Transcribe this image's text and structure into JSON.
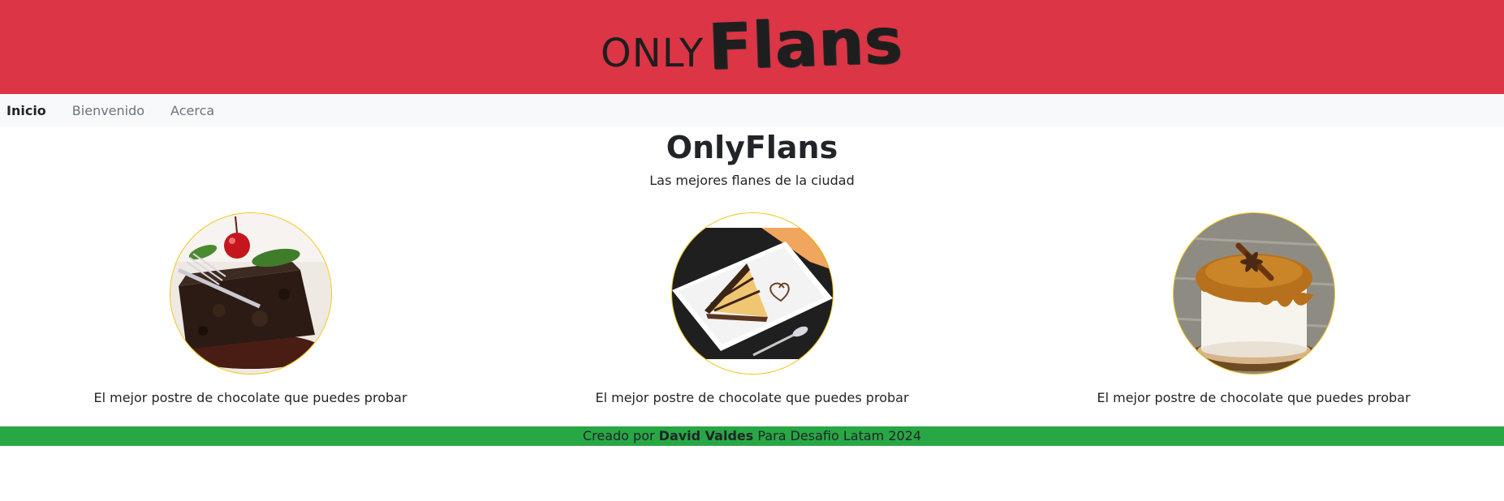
{
  "header": {
    "logo_only": "ONLY",
    "logo_flans": "Flans",
    "background_color": "#dc3545"
  },
  "nav": {
    "items": [
      {
        "label": "Inicio",
        "active": true
      },
      {
        "label": "Bienvenido",
        "active": false
      },
      {
        "label": "Acerca",
        "active": false
      }
    ]
  },
  "main": {
    "title": "OnlyFlans",
    "subtitle": "Las mejores flanes de la ciudad"
  },
  "cards": [
    {
      "image_icon": "chocolate-cake-image",
      "caption": "El mejor postre de chocolate que puedes probar"
    },
    {
      "image_icon": "cake-slice-plate-image",
      "caption": "El mejor postre de chocolate que puedes probar"
    },
    {
      "image_icon": "caramel-flan-image",
      "caption": "El mejor postre de chocolate que puedes probar"
    }
  ],
  "footer": {
    "prefix": "Creado por",
    "author": "David Valdes",
    "suffix": "Para Desafio Latam 2024",
    "background_color": "#28a745"
  }
}
